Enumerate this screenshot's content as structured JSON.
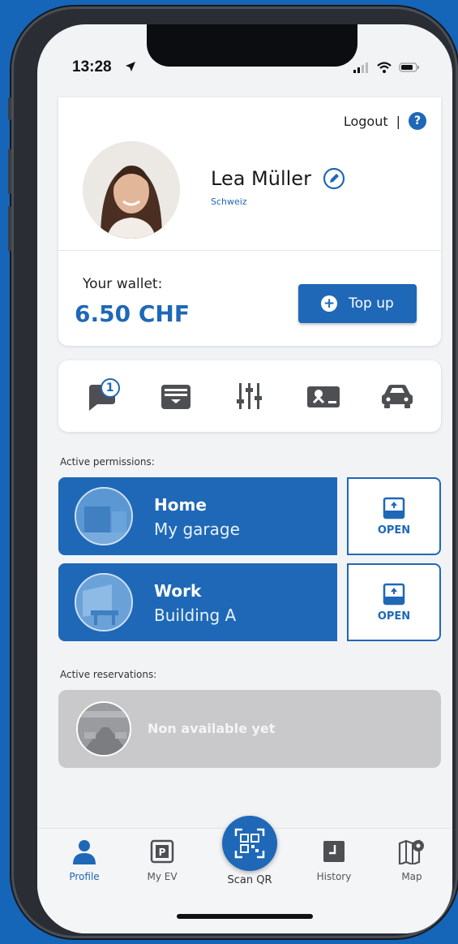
{
  "status": {
    "time": "13:28"
  },
  "header": {
    "logout": "Logout",
    "separator": "|",
    "help": "?"
  },
  "profile": {
    "name": "Lea Müller",
    "country": "Schweiz"
  },
  "wallet": {
    "label": "Your wallet:",
    "amount": "6.50 CHF",
    "topup_label": "Top up"
  },
  "quick_icons": [
    {
      "icon": "chat-icon",
      "badge": "1"
    },
    {
      "icon": "wallet-card-icon"
    },
    {
      "icon": "sliders-icon"
    },
    {
      "icon": "ticket-icon"
    },
    {
      "icon": "car-icon"
    }
  ],
  "permissions": {
    "label": "Active permissions:",
    "items": [
      {
        "title": "Home",
        "subtitle": "My garage",
        "open_label": "OPEN"
      },
      {
        "title": "Work",
        "subtitle": "Building A",
        "open_label": "OPEN"
      }
    ]
  },
  "reservations": {
    "label": "Active reservations:",
    "empty_text": "Non available yet"
  },
  "tabbar": {
    "items": [
      {
        "label": "Profile",
        "icon": "person-icon",
        "active": true
      },
      {
        "label": "My EV",
        "icon": "parking-icon"
      },
      {
        "label": "Scan QR",
        "icon": "qr-icon"
      },
      {
        "label": "History",
        "icon": "history-icon"
      },
      {
        "label": "Map",
        "icon": "map-icon"
      }
    ]
  },
  "colors": {
    "accent": "#1e68b7",
    "background": "#1565b8",
    "disabled": "#c9c9cb"
  }
}
